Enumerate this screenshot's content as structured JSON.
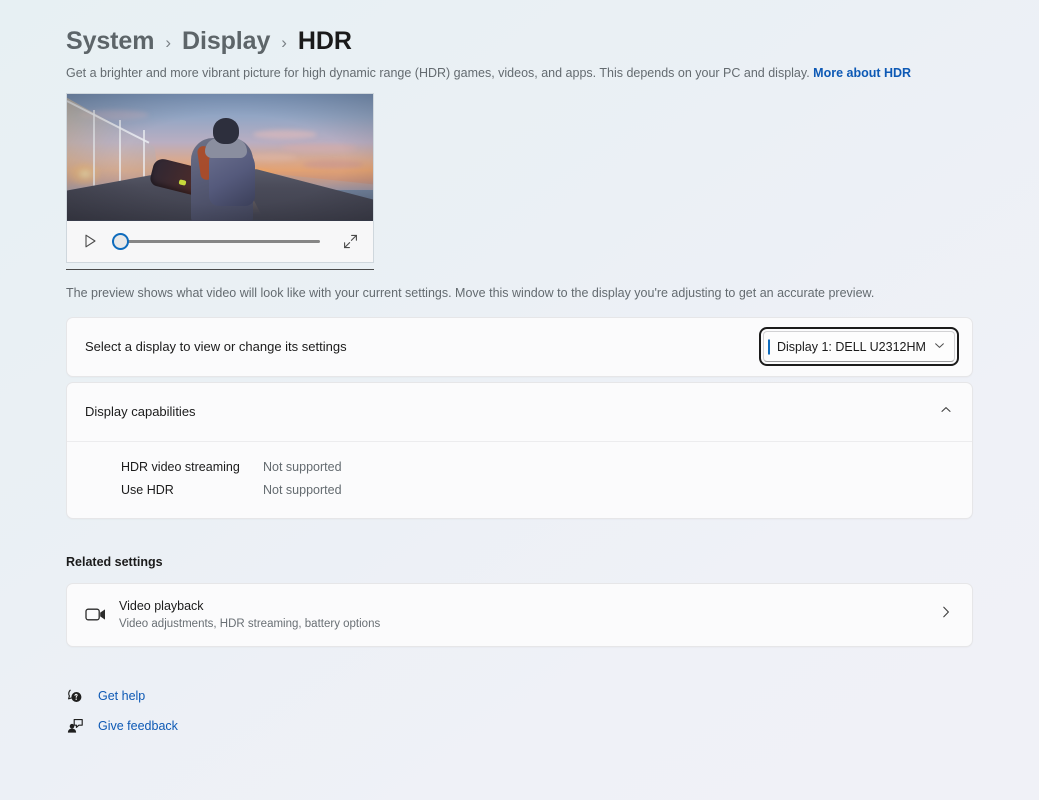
{
  "breadcrumb": {
    "items": [
      {
        "label": "System",
        "current": false
      },
      {
        "label": "Display",
        "current": false
      },
      {
        "label": "HDR",
        "current": true
      }
    ],
    "separator": "›"
  },
  "description": {
    "text": "Get a brighter and more vibrant picture for high dynamic range (HDR) games, videos, and apps. This depends on your PC and display.",
    "link_label": "More about HDR"
  },
  "preview": {
    "scene_description": "Person walking along a pier at sunset carrying a snowboard bag",
    "play_icon": "play-icon",
    "expand_icon": "expand-icon",
    "slider_value": 0,
    "note": "The preview shows what video will look like with your current settings. Move this window to the display you're adjusting to get an accurate preview."
  },
  "display_selector": {
    "label": "Select a display to view or change its settings",
    "selected_value": "Display 1: DELL U2312HM",
    "chevron_icon": "chevron-down-icon"
  },
  "display_capabilities": {
    "title": "Display capabilities",
    "expanded": true,
    "chevron_icon": "chevron-up-icon",
    "rows": [
      {
        "name": "HDR video streaming",
        "value": "Not supported"
      },
      {
        "name": "Use HDR",
        "value": "Not supported"
      }
    ]
  },
  "related_settings": {
    "heading": "Related settings",
    "items": [
      {
        "icon": "video-camera-icon",
        "title": "Video playback",
        "subtitle": "Video adjustments, HDR streaming, battery options",
        "chevron_icon": "chevron-right-icon"
      }
    ]
  },
  "footer_links": [
    {
      "icon": "get-help-icon",
      "label": "Get help"
    },
    {
      "icon": "give-feedback-icon",
      "label": "Give feedback"
    }
  ],
  "colors": {
    "accent": "#0f6cbd",
    "link": "#0d59b5",
    "text_primary": "#1b1b1b",
    "text_secondary": "#646b70",
    "card_background": "#fbfbfc",
    "page_background": "#ecf1f5"
  }
}
